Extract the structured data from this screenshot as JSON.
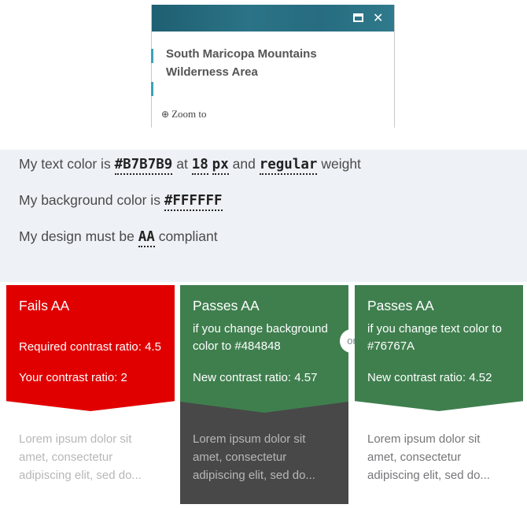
{
  "popup": {
    "title": "South Maricopa Mountains Wilderness Area",
    "zoom_label": "Zoom to",
    "maximize_icon": "maximize-icon",
    "close_icon": "close-icon"
  },
  "settings": {
    "text_color_prefix": "My text color is",
    "text_color_value": "#B7B7B9",
    "at_label": "at",
    "font_size_value": "18",
    "font_unit_value": "px",
    "and_label": "and",
    "weight_value": "regular",
    "weight_suffix": "weight",
    "bg_prefix": "My background color is",
    "bg_value": "#FFFFFF",
    "compliance_prefix": "My design must be",
    "compliance_value": "AA",
    "compliance_suffix": "compliant"
  },
  "cards": {
    "fail": {
      "title": "Fails AA",
      "required": "Required contrast ratio: 4.5",
      "yours": "Your contrast ratio: 2",
      "sample": "Lorem ipsum dolor sit amet, consectetur adipiscing elit, sed do...",
      "head_color": "#E00000",
      "sample_color": "#B7B7B9"
    },
    "bg_change": {
      "title": "Passes AA",
      "desc": "if you change background color to #484848",
      "ratio": "New contrast ratio: 4.57",
      "sample": "Lorem ipsum dolor sit amet, consectetur adipiscing elit, sed do...",
      "head_color": "#3F7F4E",
      "sample_bg": "#484848",
      "sample_color": "#B7B7B9"
    },
    "or_label": "or",
    "text_change": {
      "title": "Passes AA",
      "desc": "if you change text color to #76767A",
      "ratio": "New contrast ratio: 4.52",
      "sample": "Lorem ipsum dolor sit amet, consectetur adipiscing elit, sed do...",
      "head_color": "#3F7F4E",
      "sample_color": "#76767A"
    }
  }
}
